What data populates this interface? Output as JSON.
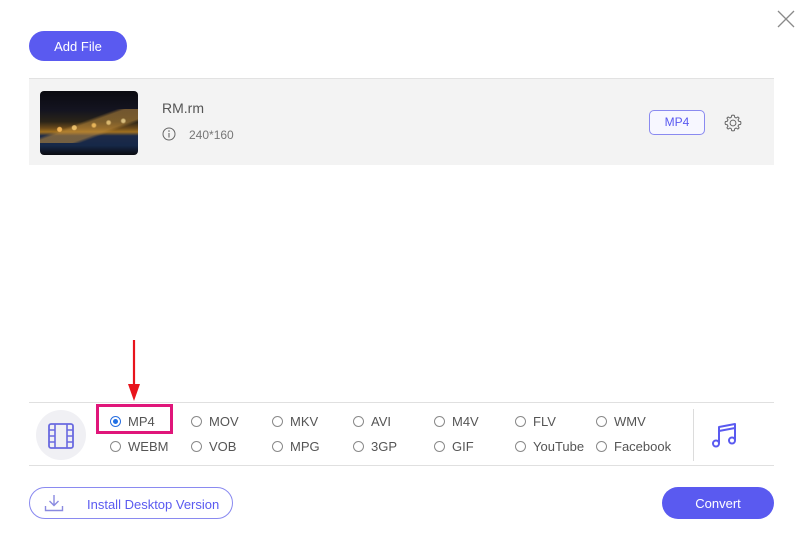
{
  "toolbar": {
    "add_file_label": "Add File",
    "close_icon": "close-icon"
  },
  "file": {
    "name": "RM.rm",
    "resolution": "240*160",
    "output_format": "MP4",
    "thumbnail": "night-city-harbor-thumbnail",
    "info_icon": "info-icon",
    "settings_icon": "gear-icon"
  },
  "formats": {
    "selected": "MP4",
    "video_tab_icon": "film-icon",
    "audio_tab_icon": "music-note-icon",
    "options": [
      {
        "label": "MP4",
        "checked": true
      },
      {
        "label": "MOV",
        "checked": false
      },
      {
        "label": "MKV",
        "checked": false
      },
      {
        "label": "AVI",
        "checked": false
      },
      {
        "label": "M4V",
        "checked": false
      },
      {
        "label": "FLV",
        "checked": false
      },
      {
        "label": "WMV",
        "checked": false
      },
      {
        "label": "WEBM",
        "checked": false
      },
      {
        "label": "VOB",
        "checked": false
      },
      {
        "label": "MPG",
        "checked": false
      },
      {
        "label": "3GP",
        "checked": false
      },
      {
        "label": "GIF",
        "checked": false
      },
      {
        "label": "YouTube",
        "checked": false
      },
      {
        "label": "Facebook",
        "checked": false
      }
    ]
  },
  "annotation": {
    "arrow_color": "#e8141c",
    "highlight_color": "#e0167a"
  },
  "footer": {
    "install_label": "Install Desktop Version",
    "convert_label": "Convert"
  },
  "colors": {
    "accent": "#5a5af0",
    "radio_selected": "#1f6fe5"
  }
}
